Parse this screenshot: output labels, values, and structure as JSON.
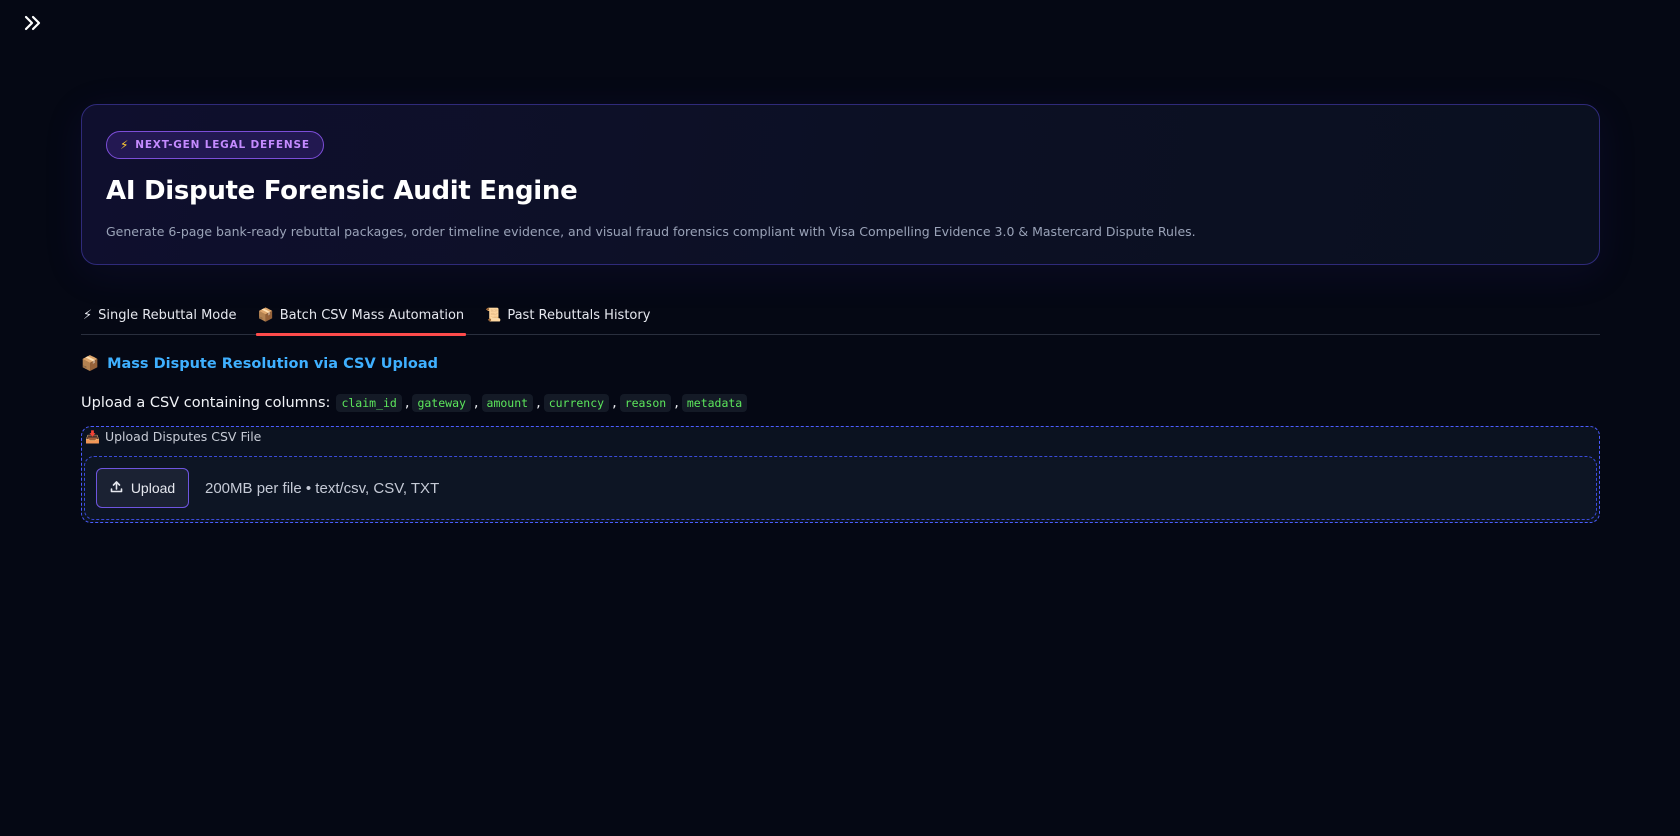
{
  "hero": {
    "badge": "NEXT-GEN LEGAL DEFENSE",
    "title": "AI Dispute Forensic Audit Engine",
    "subtitle": "Generate 6-page bank-ready rebuttal packages, order timeline evidence, and visual fraud forensics compliant with Visa Compelling Evidence 3.0 & Mastercard Dispute Rules."
  },
  "tabs": [
    {
      "emoji": "⚡",
      "label": "Single Rebuttal Mode",
      "active": false
    },
    {
      "emoji": "📦",
      "label": "Batch CSV Mass Automation",
      "active": true
    },
    {
      "emoji": "📜",
      "label": "Past Rebuttals History",
      "active": false
    }
  ],
  "section": {
    "emoji": "📦",
    "heading": "Mass Dispute Resolution via CSV Upload",
    "columns_intro": "Upload a CSV containing columns:",
    "columns": [
      "claim_id",
      "gateway",
      "amount",
      "currency",
      "reason",
      "metadata"
    ]
  },
  "uploader": {
    "label_emoji": "📥",
    "label": "Upload Disputes CSV File",
    "button_label": "Upload",
    "hint": "200MB per file • text/csv, CSV, TXT"
  },
  "colors": {
    "accent_tab": "#ff4b4b",
    "heading_blue": "#3fb0ff",
    "code_green": "#5ce65c",
    "badge_purple": "#c58bff"
  }
}
